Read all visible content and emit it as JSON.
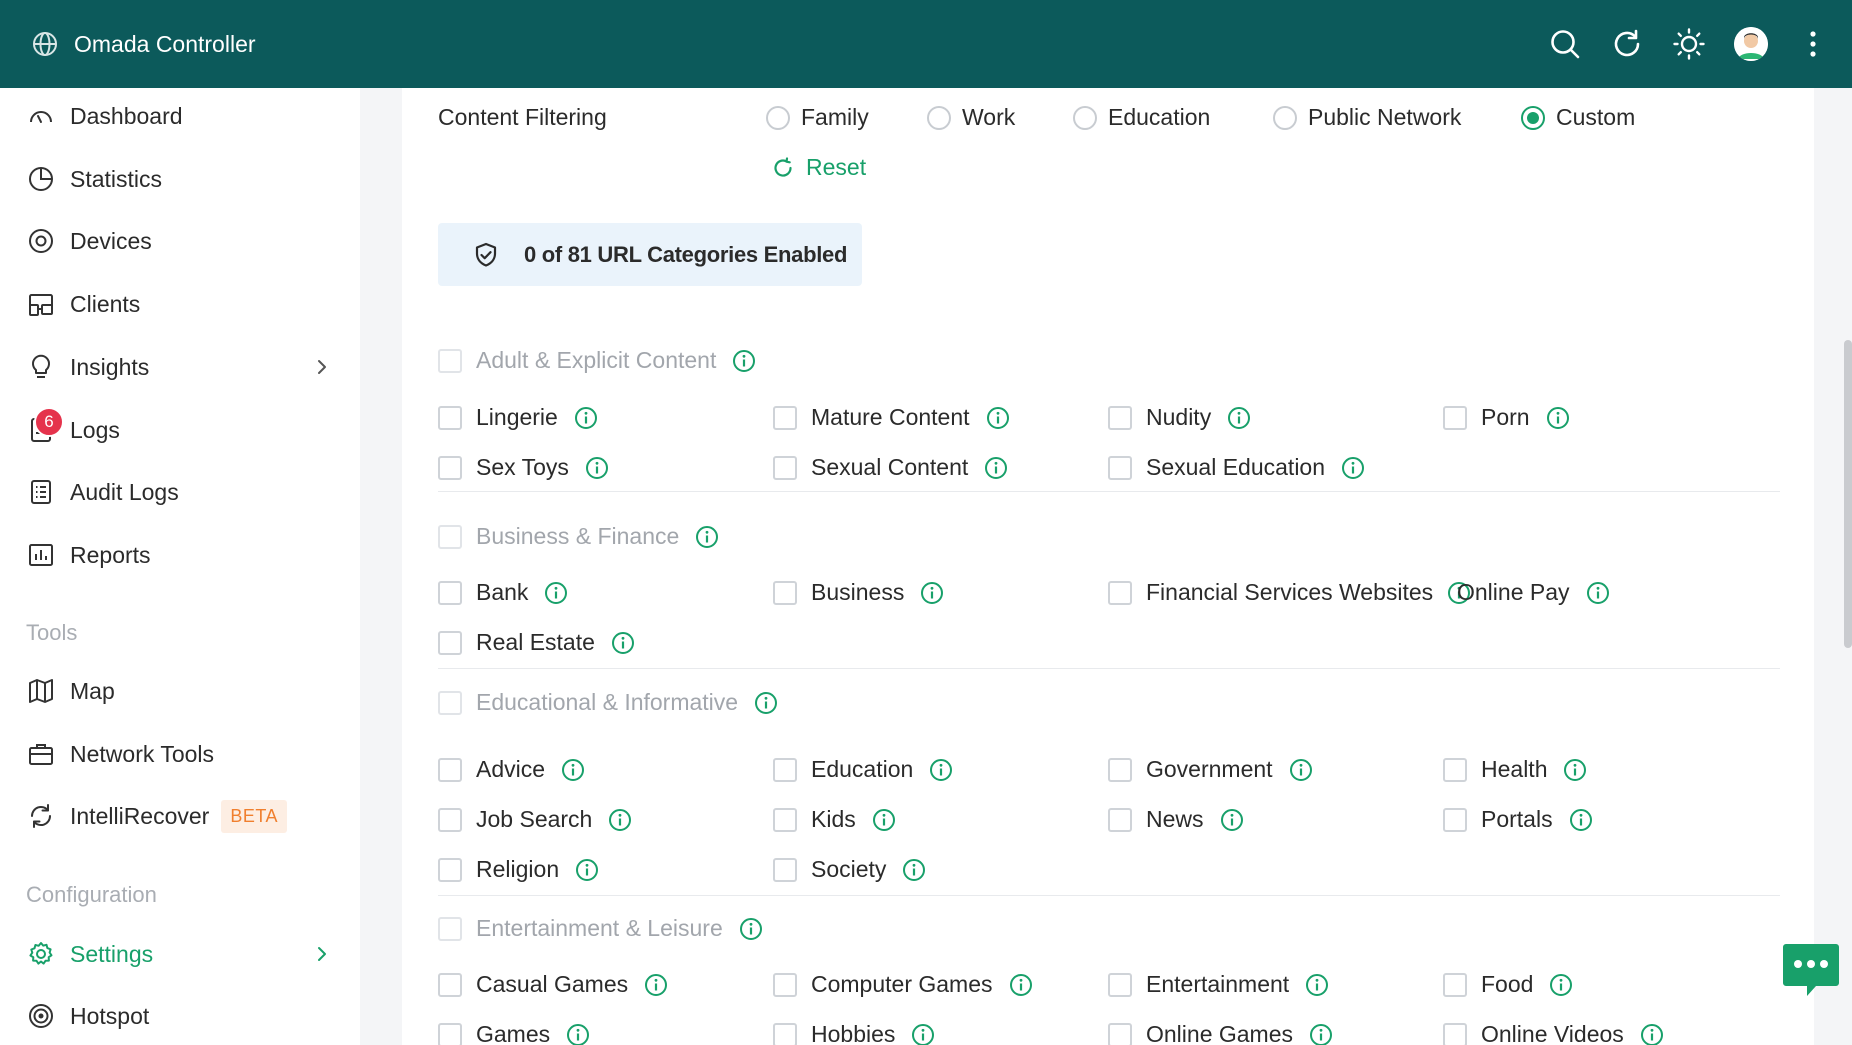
{
  "header": {
    "app_title": "Omada Controller",
    "icons": [
      "search-icon",
      "refresh-icon",
      "theme-sun-icon",
      "user-avatar",
      "more-menu-icon"
    ]
  },
  "sidebar": {
    "items": [
      {
        "label": "Dashboard",
        "icon": "dashboard-icon"
      },
      {
        "label": "Statistics",
        "icon": "pie-chart-icon"
      },
      {
        "label": "Devices",
        "icon": "devices-icon"
      },
      {
        "label": "Clients",
        "icon": "clients-icon"
      },
      {
        "label": "Insights",
        "icon": "lightbulb-icon"
      },
      {
        "label": "Logs",
        "icon": "logs-icon",
        "badge": "6"
      },
      {
        "label": "Audit Logs",
        "icon": "audit-logs-icon"
      },
      {
        "label": "Reports",
        "icon": "reports-icon"
      }
    ],
    "tools_title": "Tools",
    "tools": [
      {
        "label": "Map",
        "icon": "map-icon"
      },
      {
        "label": "Network Tools",
        "icon": "toolbox-icon"
      },
      {
        "label": "IntelliRecover",
        "icon": "recover-icon",
        "tag": "BETA"
      }
    ],
    "config_title": "Configuration",
    "config": [
      {
        "label": "Settings",
        "icon": "gear-icon"
      },
      {
        "label": "Hotspot",
        "icon": "hotspot-icon"
      }
    ]
  },
  "content_filtering": {
    "label": "Content Filtering",
    "options": [
      "Family",
      "Work",
      "Education",
      "Public Network",
      "Custom"
    ],
    "selected": "Custom",
    "reset_label": "Reset",
    "summary": "0 of 81 URL Categories Enabled"
  },
  "categories": [
    {
      "name": "Adult & Explicit Content",
      "items": [
        "Lingerie",
        "Mature Content",
        "Nudity",
        "Porn",
        "Sex Toys",
        "Sexual Content",
        "Sexual Education"
      ]
    },
    {
      "name": "Business & Finance",
      "items": [
        "Bank",
        "Business",
        "Financial Services Websites",
        "Online Pay",
        "Real Estate"
      ]
    },
    {
      "name": "Educational & Informative",
      "items": [
        "Advice",
        "Education",
        "Government",
        "Health",
        "Job Search",
        "Kids",
        "News",
        "Portals",
        "Religion",
        "Society"
      ]
    },
    {
      "name": "Entertainment & Leisure",
      "items": [
        "Casual Games",
        "Computer Games",
        "Entertainment",
        "Food",
        "Games",
        "Hobbies",
        "Online Games",
        "Online Videos"
      ]
    }
  ],
  "colors": {
    "header": "#0c5a5b",
    "accent": "#18a06a",
    "badge": "#e5334c",
    "beta": "#f07f2e"
  }
}
